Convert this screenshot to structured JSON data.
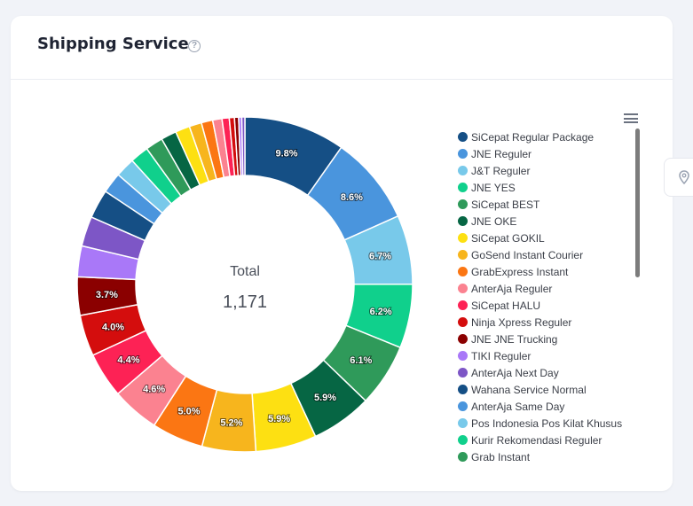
{
  "card": {
    "title": "Shipping Service"
  },
  "icons": {
    "help": "help-circle-icon",
    "menu": "hamburger-menu-icon",
    "location": "location-pin-icon"
  },
  "chart_data": {
    "type": "pie",
    "center_label": "Total",
    "center_value": "1,171",
    "slices": [
      {
        "name": "SiCepat Regular Package",
        "value": 9.8,
        "color": "#154f85",
        "label": "9.8%"
      },
      {
        "name": "JNE Reguler",
        "value": 8.6,
        "color": "#4a95dd",
        "label": "8.6%"
      },
      {
        "name": "J&T Reguler",
        "value": 6.7,
        "color": "#78c9ea",
        "label": "6.7%"
      },
      {
        "name": "JNE YES",
        "value": 6.2,
        "color": "#10d08c",
        "label": "6.2%"
      },
      {
        "name": "SiCepat BEST",
        "value": 6.1,
        "color": "#2f9a5a",
        "label": "6.1%"
      },
      {
        "name": "JNE OKE",
        "value": 5.9,
        "color": "#066644",
        "label": "5.9%"
      },
      {
        "name": "SiCepat GOKIL",
        "value": 5.9,
        "color": "#fde012",
        "label": "5.9%"
      },
      {
        "name": "GoSend Instant Courier",
        "value": 5.2,
        "color": "#f7b51d",
        "label": "5.2%"
      },
      {
        "name": "GrabExpress Instant",
        "value": 5.0,
        "color": "#fb7613",
        "label": "5.0%"
      },
      {
        "name": "AnterAja Reguler",
        "value": 4.6,
        "color": "#fb8290",
        "label": "4.6%"
      },
      {
        "name": "SiCepat HALU",
        "value": 4.4,
        "color": "#fd2255",
        "label": "4.4%"
      },
      {
        "name": "Ninja Xpress Reguler",
        "value": 4.0,
        "color": "#d40d0d",
        "label": "4.0%"
      },
      {
        "name": "JNE JNE Trucking",
        "value": 3.7,
        "color": "#8b0000",
        "label": "3.7%"
      },
      {
        "name": "TIKI Reguler",
        "value": 3.0,
        "color": "#a978f8",
        "label": ""
      },
      {
        "name": "AnterAja Next Day",
        "value": 2.9,
        "color": "#7d56c6",
        "label": ""
      },
      {
        "name": "Wahana Service Normal",
        "value": 2.8,
        "color": "#154f85",
        "label": ""
      },
      {
        "name": "AnterAja Same Day",
        "value": 2.0,
        "color": "#4a95dd",
        "label": ""
      },
      {
        "name": "Pos Indonesia Pos Kilat Khusus",
        "value": 1.9,
        "color": "#78c9ea",
        "label": ""
      },
      {
        "name": "Kurir Rekomendasi Reguler",
        "value": 1.8,
        "color": "#10d08c",
        "label": ""
      },
      {
        "name": "Grab Instant",
        "value": 1.7,
        "color": "#2f9a5a",
        "label": ""
      },
      {
        "name": "",
        "value": 1.5,
        "color": "#066644",
        "label": ""
      },
      {
        "name": "",
        "value": 1.4,
        "color": "#fde012",
        "label": ""
      },
      {
        "name": "",
        "value": 1.2,
        "color": "#f7b51d",
        "label": ""
      },
      {
        "name": "",
        "value": 1.1,
        "color": "#fb7613",
        "label": ""
      },
      {
        "name": "",
        "value": 0.9,
        "color": "#fb8290",
        "label": ""
      },
      {
        "name": "",
        "value": 0.7,
        "color": "#fd2255",
        "label": ""
      },
      {
        "name": "",
        "value": 0.5,
        "color": "#d40d0d",
        "label": ""
      },
      {
        "name": "",
        "value": 0.4,
        "color": "#8b0000",
        "label": ""
      },
      {
        "name": "",
        "value": 0.3,
        "color": "#a978f8",
        "label": ""
      },
      {
        "name": "",
        "value": 0.3,
        "color": "#7d56c6",
        "label": ""
      }
    ]
  }
}
